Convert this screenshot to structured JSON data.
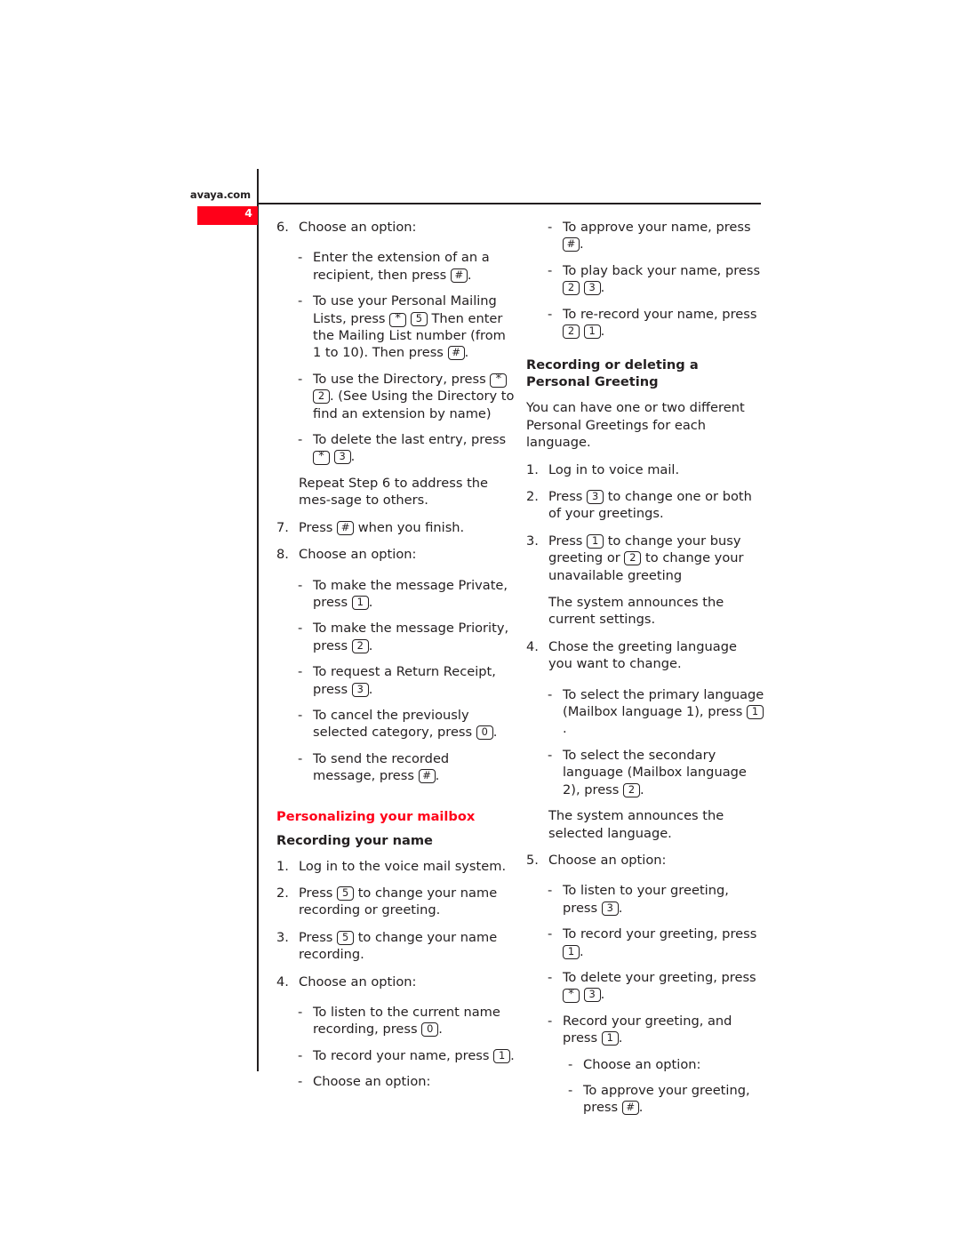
{
  "page": {
    "brand": "avaya.com",
    "page_number": "4",
    "accent_color": "#ff0019",
    "text_color": "#231f20"
  },
  "left_column": [
    {
      "kind": "step",
      "number": "6.",
      "parts": [
        {
          "t": "Choose an option:"
        }
      ]
    },
    {
      "kind": "spacer-sm"
    },
    {
      "kind": "dash",
      "parts": [
        {
          "t": "Enter the extension of an a recipient, then press "
        },
        {
          "key": "#"
        },
        {
          "t": "."
        }
      ]
    },
    {
      "kind": "dash",
      "parts": [
        {
          "t": "To use your Personal Mailing Lists, press "
        },
        {
          "key": "*"
        },
        {
          "t": " "
        },
        {
          "key": "5"
        },
        {
          "t": " Then enter the Mailing List number (from 1 to 10). Then press "
        },
        {
          "key": "#"
        },
        {
          "t": "."
        }
      ]
    },
    {
      "kind": "dash",
      "parts": [
        {
          "t": "To use the Directory, press "
        },
        {
          "key": "*"
        },
        {
          "t": " "
        },
        {
          "key": "2"
        },
        {
          "t": ". (See Using the Directory to find an extension by name)"
        }
      ]
    },
    {
      "kind": "dash",
      "parts": [
        {
          "t": "To delete the last entry, press "
        },
        {
          "key": "*"
        },
        {
          "t": " "
        },
        {
          "key": "3"
        },
        {
          "t": "."
        }
      ]
    },
    {
      "kind": "cont",
      "parts": [
        {
          "t": "Repeat Step 6 to address the mes-sage to others."
        }
      ]
    },
    {
      "kind": "step",
      "number": "7.",
      "parts": [
        {
          "t": "Press "
        },
        {
          "key": "#"
        },
        {
          "t": " when you finish."
        }
      ]
    },
    {
      "kind": "step",
      "number": "8.",
      "parts": [
        {
          "t": "Choose an option:"
        }
      ]
    },
    {
      "kind": "spacer-sm"
    },
    {
      "kind": "dash",
      "parts": [
        {
          "t": "To make the message Private, press "
        },
        {
          "key": "1"
        },
        {
          "t": "."
        }
      ]
    },
    {
      "kind": "dash",
      "parts": [
        {
          "t": "To make the message Priority, press "
        },
        {
          "key": "2"
        },
        {
          "t": "."
        }
      ]
    },
    {
      "kind": "dash",
      "parts": [
        {
          "t": "To request a Return Receipt, press "
        },
        {
          "key": "3"
        },
        {
          "t": "."
        }
      ]
    },
    {
      "kind": "dash",
      "parts": [
        {
          "t": "To cancel the previously selected category, press "
        },
        {
          "key": "0"
        },
        {
          "t": "."
        }
      ]
    },
    {
      "kind": "dash",
      "parts": [
        {
          "t": "To send the recorded message, press "
        },
        {
          "key": "#"
        },
        {
          "t": "."
        }
      ]
    },
    {
      "kind": "spacer-lg"
    },
    {
      "kind": "h-red",
      "parts": [
        {
          "t": "Personalizing your mailbox"
        }
      ]
    },
    {
      "kind": "h-black",
      "parts": [
        {
          "t": "Recording your name"
        }
      ]
    },
    {
      "kind": "step",
      "number": "1.",
      "parts": [
        {
          "t": "Log in to the voice mail system."
        }
      ]
    },
    {
      "kind": "step",
      "number": "2.",
      "parts": [
        {
          "t": "Press "
        },
        {
          "key": "5"
        },
        {
          "t": " to change your name recording or greeting."
        }
      ]
    },
    {
      "kind": "step",
      "number": "3.",
      "parts": [
        {
          "t": "Press "
        },
        {
          "key": "5"
        },
        {
          "t": " to change your name recording."
        }
      ]
    },
    {
      "kind": "step",
      "number": "4.",
      "parts": [
        {
          "t": "Choose an option:"
        }
      ]
    },
    {
      "kind": "spacer-sm"
    },
    {
      "kind": "dash",
      "parts": [
        {
          "t": "To listen to the current name recording, press "
        },
        {
          "key": "0"
        },
        {
          "t": "."
        }
      ]
    },
    {
      "kind": "dash",
      "parts": [
        {
          "t": "To record your name, press "
        },
        {
          "key": "1"
        },
        {
          "t": "."
        }
      ]
    },
    {
      "kind": "dash",
      "parts": [
        {
          "t": "Choose an option:"
        }
      ]
    }
  ],
  "right_column": [
    {
      "kind": "dash",
      "parts": [
        {
          "t": "To approve your name, press "
        },
        {
          "key": "#"
        },
        {
          "t": "."
        }
      ]
    },
    {
      "kind": "dash",
      "parts": [
        {
          "t": "To play back your name, press "
        },
        {
          "key": "2"
        },
        {
          "t": " "
        },
        {
          "key": "3"
        },
        {
          "t": "."
        }
      ]
    },
    {
      "kind": "dash",
      "parts": [
        {
          "t": "To re-record your name, press "
        },
        {
          "key": "2"
        },
        {
          "t": " "
        },
        {
          "key": "1"
        },
        {
          "t": "."
        }
      ]
    },
    {
      "kind": "spacer-md"
    },
    {
      "kind": "h-black",
      "parts": [
        {
          "t": "Recording or deleting a Personal Greeting"
        }
      ]
    },
    {
      "kind": "body-p",
      "parts": [
        {
          "t": "You can have one or two different Personal Greetings for each language."
        }
      ]
    },
    {
      "kind": "step",
      "number": "1.",
      "parts": [
        {
          "t": "Log in to voice mail."
        }
      ]
    },
    {
      "kind": "step",
      "number": "2.",
      "parts": [
        {
          "t": "Press "
        },
        {
          "key": "3"
        },
        {
          "t": " to change one or both of your greetings."
        }
      ]
    },
    {
      "kind": "step",
      "number": "3.",
      "parts": [
        {
          "t": "Press "
        },
        {
          "key": "1"
        },
        {
          "t": " to change your busy greeting or "
        },
        {
          "key": "2"
        },
        {
          "t": " to change your unavailable greeting"
        }
      ]
    },
    {
      "kind": "cont",
      "parts": [
        {
          "t": "The system announces the current settings."
        }
      ]
    },
    {
      "kind": "step",
      "number": "4.",
      "parts": [
        {
          "t": "Chose the greeting language you want to change."
        }
      ]
    },
    {
      "kind": "spacer-sm"
    },
    {
      "kind": "dash",
      "parts": [
        {
          "t": "To select the primary language (Mailbox language 1), press "
        },
        {
          "key": "1"
        },
        {
          "t": "."
        }
      ]
    },
    {
      "kind": "dash",
      "parts": [
        {
          "t": "To select the secondary language (Mailbox language 2), press "
        },
        {
          "key": "2"
        },
        {
          "t": "."
        }
      ]
    },
    {
      "kind": "cont",
      "parts": [
        {
          "t": "The system announces the selected language."
        }
      ]
    },
    {
      "kind": "step",
      "number": "5.",
      "parts": [
        {
          "t": "Choose an option:"
        }
      ]
    },
    {
      "kind": "spacer-sm"
    },
    {
      "kind": "dash",
      "parts": [
        {
          "t": "To listen to your greeting, press "
        },
        {
          "key": "3"
        },
        {
          "t": "."
        }
      ]
    },
    {
      "kind": "dash",
      "parts": [
        {
          "t": "To record your greeting, press "
        },
        {
          "key": "1"
        },
        {
          "t": "."
        }
      ]
    },
    {
      "kind": "dash",
      "parts": [
        {
          "t": "To delete your greeting, press "
        },
        {
          "key": "*"
        },
        {
          "t": " "
        },
        {
          "key": "3"
        },
        {
          "t": "."
        }
      ]
    },
    {
      "kind": "dash",
      "parts": [
        {
          "t": "Record your greeting, and press "
        },
        {
          "key": "1"
        },
        {
          "t": "."
        }
      ]
    },
    {
      "kind": "dash2",
      "parts": [
        {
          "t": "Choose an option:"
        }
      ]
    },
    {
      "kind": "dash2",
      "parts": [
        {
          "t": "To approve your greeting, press "
        },
        {
          "key": "#"
        },
        {
          "t": "."
        }
      ]
    }
  ]
}
